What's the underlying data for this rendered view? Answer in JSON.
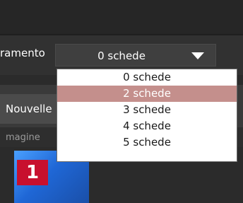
{
  "toolbar": {
    "field_label": "ramento",
    "combo": {
      "value": "0 schede",
      "arrow_icon": "triangle-down-icon"
    }
  },
  "dropdown": {
    "options": [
      "0 schede",
      "2 schede",
      "3 schede",
      "4 schede",
      "5 schede"
    ],
    "selected_index": 1
  },
  "panel": {
    "tab_label": "Nouvelle",
    "section_label": "magine"
  },
  "thumbnail": {
    "badge_number": "1",
    "colors": {
      "badge": "#c8102e",
      "selection": "#c48f8c",
      "thumb": "#1f67d6"
    }
  }
}
